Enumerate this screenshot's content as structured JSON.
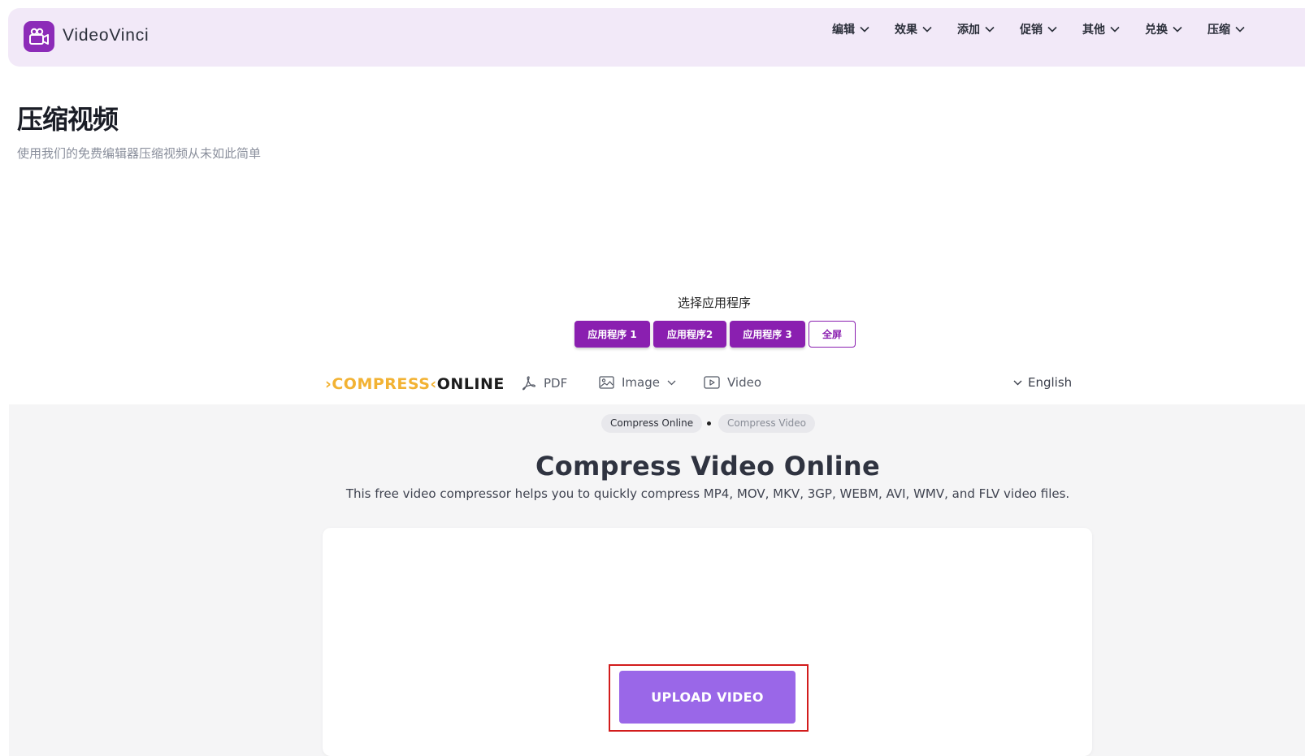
{
  "header": {
    "brand": "VideoVinci",
    "nav": [
      {
        "label": "编辑",
        "icon": "chevron-down-icon"
      },
      {
        "label": "效果",
        "icon": "chevron-down-icon"
      },
      {
        "label": "添加",
        "icon": "chevron-down-icon"
      },
      {
        "label": "促销",
        "icon": "chevron-down-icon"
      },
      {
        "label": "其他",
        "icon": "chevron-down-icon"
      },
      {
        "label": "兑换",
        "icon": "chevron-down-icon"
      },
      {
        "label": "压缩",
        "icon": "chevron-down-icon"
      }
    ]
  },
  "page": {
    "title": "压缩视频",
    "subtitle": "使用我们的免费编辑器压缩视频从未如此简单"
  },
  "app_selector": {
    "label": "选择应用程序",
    "buttons": [
      "应用程序 1",
      "应用程序2",
      "应用程序 3",
      "全屏"
    ]
  },
  "embed": {
    "logo_left": "COMPRESS",
    "logo_right": "ONLINE",
    "links": {
      "pdf": "PDF",
      "image": "Image",
      "video": "Video"
    },
    "language": "English",
    "breadcrumb": [
      "Compress Online",
      "Compress Video"
    ],
    "hero_title": "Compress Video Online",
    "hero_desc": "This free video compressor helps you to quickly compress MP4, MOV, MKV, 3GP, WEBM, AVI, WMV, and FLV video files.",
    "upload_label": "UPLOAD VIDEO"
  },
  "colors": {
    "brand_purple": "#8a1fb0",
    "header_bg": "#f2e9f8",
    "upload_button": "#9a67e8",
    "logo_yellow": "#f2b233",
    "highlight_red": "#d21c1c"
  }
}
